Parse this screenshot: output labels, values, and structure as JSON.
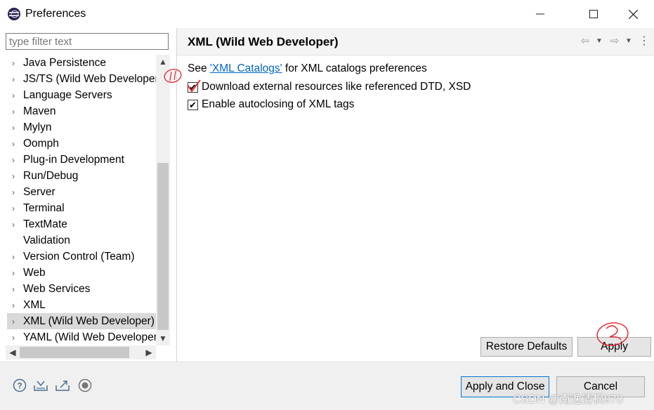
{
  "window": {
    "title": "Preferences",
    "minimize": "─",
    "maximize": "☐",
    "close": "✕"
  },
  "filter": {
    "placeholder": "type filter text",
    "value": ""
  },
  "tree": {
    "items": [
      {
        "label": "Java Persistence",
        "arrow": "›"
      },
      {
        "label": "JS/TS (Wild Web Developer)",
        "arrow": "›"
      },
      {
        "label": "Language Servers",
        "arrow": "›"
      },
      {
        "label": "Maven",
        "arrow": "›"
      },
      {
        "label": "Mylyn",
        "arrow": "›"
      },
      {
        "label": "Oomph",
        "arrow": "›"
      },
      {
        "label": "Plug-in Development",
        "arrow": "›"
      },
      {
        "label": "Run/Debug",
        "arrow": "›"
      },
      {
        "label": "Server",
        "arrow": "›"
      },
      {
        "label": "Terminal",
        "arrow": "›"
      },
      {
        "label": "TextMate",
        "arrow": "›"
      },
      {
        "label": "Validation",
        "arrow": ""
      },
      {
        "label": "Version Control (Team)",
        "arrow": "›"
      },
      {
        "label": "Web",
        "arrow": "›"
      },
      {
        "label": "Web Services",
        "arrow": "›"
      },
      {
        "label": "XML",
        "arrow": "›"
      },
      {
        "label": "XML (Wild Web Developer)",
        "arrow": "›",
        "selected": true
      },
      {
        "label": "YAML (Wild Web Developer)",
        "arrow": "›"
      }
    ]
  },
  "page": {
    "title": "XML (Wild Web Developer)",
    "see_prefix": "See ",
    "see_link": "'XML Catalogs'",
    "see_suffix": " for XML catalogs preferences",
    "options": [
      {
        "label": "Download external resources like referenced DTD, XSD",
        "checked": true
      },
      {
        "label": "Enable autoclosing of XML tags",
        "checked": true
      }
    ],
    "restore_defaults": "Restore Defaults",
    "apply": "Apply"
  },
  "footer": {
    "apply_and_close": "Apply and Close",
    "cancel": "Cancel"
  },
  "annotations": {
    "mark1": "①",
    "mark2": "②"
  },
  "watermark": "CSDN @南逸清枫970",
  "colors": {
    "link": "#0066cc",
    "annotation_red": "#e8202a",
    "selected_row": "#d9d9d9",
    "default_button_border": "#0078d7"
  }
}
